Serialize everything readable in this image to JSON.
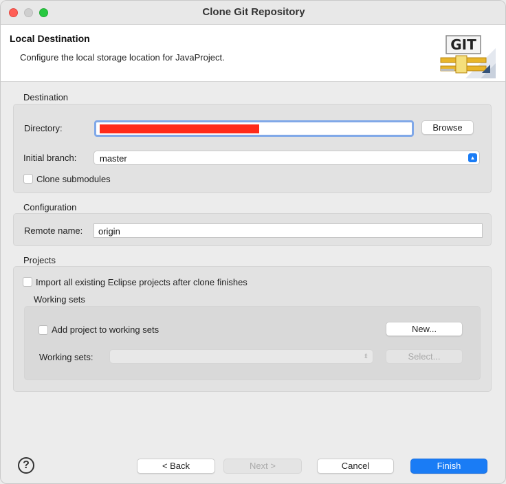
{
  "window": {
    "title": "Clone Git Repository"
  },
  "header": {
    "title": "Local Destination",
    "description": "Configure the local storage location for JavaProject.",
    "logo_text": "GIT"
  },
  "destination": {
    "section_label": "Destination",
    "directory_label": "Directory:",
    "browse_label": "Browse",
    "initial_branch_label": "Initial branch:",
    "initial_branch_value": "master",
    "clone_submodules_label": "Clone submodules"
  },
  "configuration": {
    "section_label": "Configuration",
    "remote_name_label": "Remote name:",
    "remote_name_value": "origin"
  },
  "projects": {
    "section_label": "Projects",
    "import_label": "Import all existing Eclipse projects after clone finishes",
    "working_sets_group_label": "Working sets",
    "add_to_working_sets_label": "Add project to working sets",
    "new_label": "New...",
    "working_sets_label": "Working sets:",
    "select_label": "Select..."
  },
  "footer": {
    "back_label": "< Back",
    "next_label": "Next >",
    "cancel_label": "Cancel",
    "finish_label": "Finish"
  },
  "colors": {
    "accent": "#1a7cf5",
    "redaction": "#ff2a1a"
  }
}
